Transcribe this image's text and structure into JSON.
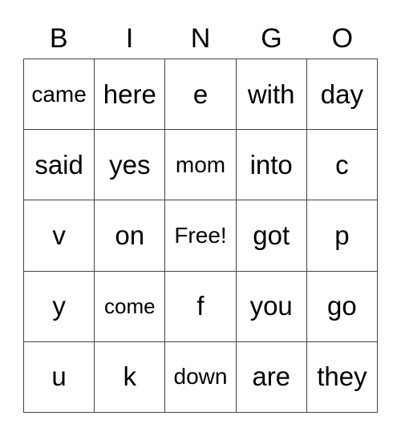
{
  "header": [
    "B",
    "I",
    "N",
    "G",
    "O"
  ],
  "rows": [
    [
      "came",
      "here",
      "e",
      "with",
      "day"
    ],
    [
      "said",
      "yes",
      "mom",
      "into",
      "c"
    ],
    [
      "v",
      "on",
      "Free!",
      "got",
      "p"
    ],
    [
      "y",
      "come",
      "f",
      "you",
      "go"
    ],
    [
      "u",
      "k",
      "down",
      "are",
      "they"
    ]
  ]
}
